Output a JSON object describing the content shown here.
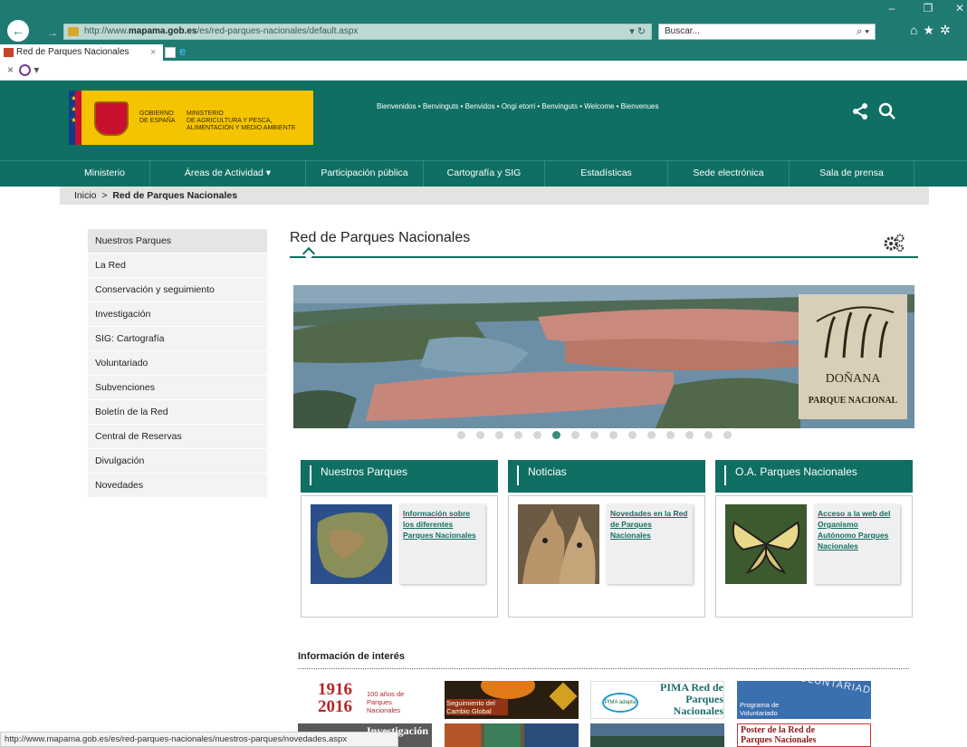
{
  "browser": {
    "url_prefix": "http://www.",
    "url_domain": "mapama.gob.es",
    "url_path": "/es/red-parques-nacionales/default.aspx",
    "search_placeholder": "Buscar...",
    "tab_title": "Red de Parques Nacionales",
    "status_url": "http://www.mapama.gob.es/es/red-parques-nacionales/nuestros-parques/novedades.aspx"
  },
  "header": {
    "gov_line1": "GOBIERNO",
    "gov_line2": "DE ESPAÑA",
    "ministry_line1": "MINISTERIO",
    "ministry_line2": "DE AGRICULTURA Y PESCA,",
    "ministry_line3": "ALIMENTACIÓN Y MEDIO AMBIENTE",
    "languages": "Bienvenidos • Benvinguts • Benvidos • Ongi etorri • Benvinguts • Welcome • Bienvenues"
  },
  "nav": {
    "items": [
      "Ministerio",
      "Áreas de Actividad",
      "Participación pública",
      "Cartografía y SIG",
      "Estadísticas",
      "Sede electrónica",
      "Sala de prensa"
    ]
  },
  "breadcrumb": {
    "home": "Inicio",
    "separator": ">",
    "current": "Red de Parques Nacionales"
  },
  "sidebar": {
    "items": [
      "Nuestros Parques",
      "La Red",
      "Conservación y seguimiento",
      "Investigación",
      "SIG: Cartografía",
      "Voluntariado",
      "Subvenciones",
      "Boletín de la Red",
      "Central de Reservas",
      "Divulgación",
      "Novedades"
    ]
  },
  "main": {
    "title": "Red de Parques Nacionales",
    "hero": {
      "badge_title": "DOÑANA",
      "badge_sub": "PARQUE NACIONAL",
      "slide_count": 15,
      "active_slide": 5
    },
    "cards": [
      {
        "title": "Nuestros Parques",
        "link": "Información sobre los diferentes Parques Nacionales"
      },
      {
        "title": "Noticias",
        "link": "Novedades en la Red de Parques Nacionales"
      },
      {
        "title": "O.A. Parques Nacionales",
        "link": "Acceso a la web del Organismo Autónomo Parques Nacionales"
      }
    ],
    "info_title": "Información de interés",
    "thumbs": {
      "centenary_years": "1916 2016",
      "centenary_year_a": "1916",
      "centenary_year_b": "2016",
      "centenary_label": "100 años de Parques Nacionales",
      "cambio_label": "Seguimiento del Cambio Global",
      "pima_label": "PIMA Red de Parques Nacionales",
      "pima_logo": "PIMA adapta",
      "voluntariado_label": "Programa de Voluntariado",
      "voluntariado_arc": "VOLUNTARIADO",
      "investigacion_label": "Investigación",
      "poster_label": "Poster de la Red de Parques Nacionales"
    }
  },
  "colors": {
    "brand": "#0f6f62",
    "chrome": "#1f7a72",
    "gov_yellow": "#f4c400"
  }
}
